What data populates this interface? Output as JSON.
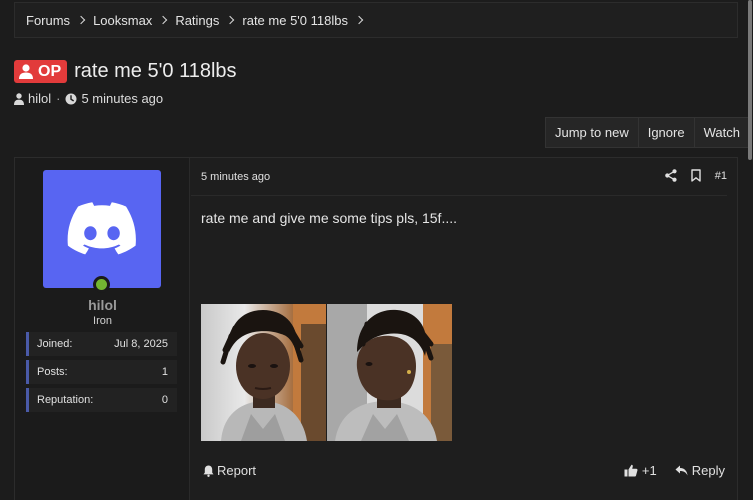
{
  "breadcrumb": [
    "Forums",
    "Looksmax",
    "Ratings",
    "rate me 5'0 118lbs"
  ],
  "thread": {
    "badge": "OP",
    "title": "rate me 5'0 118lbs",
    "author": "hilol",
    "time": "5 minutes ago"
  },
  "actions": {
    "jump": "Jump to new",
    "ignore": "Ignore",
    "watch": "Watch"
  },
  "user": {
    "name": "hilol",
    "title": "Iron",
    "avatar_color": "#5865f2",
    "online_color": "#73b632",
    "stats": [
      {
        "label": "Joined:",
        "value": "Jul 8, 2025"
      },
      {
        "label": "Posts:",
        "value": "1"
      },
      {
        "label": "Reputation:",
        "value": "0"
      }
    ]
  },
  "post": {
    "date": "5 minutes ago",
    "number": "#1",
    "text": "rate me and give me some tips pls, 15f....",
    "report": "Report",
    "like": "+1",
    "reply": "Reply"
  },
  "colors": {
    "badge": "#e23b3b",
    "background": "#1c1c1c"
  }
}
